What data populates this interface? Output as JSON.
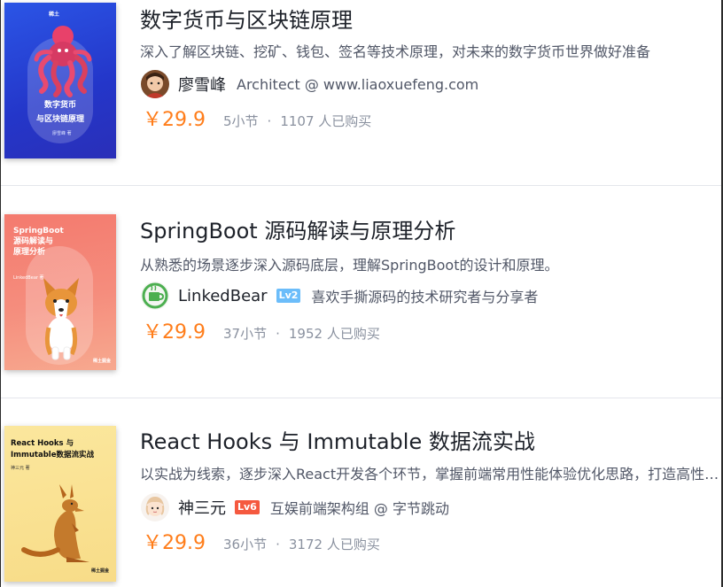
{
  "colors": {
    "price": "#ff7d1a",
    "title": "#1d2129",
    "secondary": "#515767",
    "muted": "#8a919f",
    "level_lv2": "#6cbdfa",
    "level_lv6": "#f5593f"
  },
  "books": [
    {
      "title": "数字货币与区块链原理",
      "description": "深入了解区块链、挖矿、钱包、签名等技术原理，对未来的数字货币世界做好准备",
      "cover": {
        "line1": "数字货币",
        "line2": "与区块链原理",
        "author": "廖雪峰 著",
        "brand": "稀土",
        "image": "octopus-illustration"
      },
      "author": {
        "name": "廖雪峰",
        "level": "",
        "title": "Architect @ www.liaoxuefeng.com",
        "avatar": "avatar-icon"
      },
      "price": "￥29.9",
      "sections": "5小节",
      "separator": "·",
      "buyers": "1107 人已购买"
    },
    {
      "title": "SpringBoot 源码解读与原理分析",
      "description": "从熟悉的场景逐步深入源码底层，理解SpringBoot的设计和原理。",
      "cover": {
        "line1": "SpringBoot",
        "line2": "源码解读与",
        "line3": "原理分析",
        "author": "LinkedBear 著",
        "brand": "稀土掘金",
        "image": "corgi-illustration"
      },
      "author": {
        "name": "LinkedBear",
        "level": "Lv2",
        "title": "喜欢手撕源码的技术研究者与分享者",
        "avatar": "avatar-icon"
      },
      "price": "￥29.9",
      "sections": "37小节",
      "separator": "·",
      "buyers": "1952 人已购买"
    },
    {
      "title": "React Hooks 与 Immutable 数据流实战",
      "description": "以实战为线索，逐步深入React开发各个环节，掌握前端常用性能体验优化思路，打造高性能Web应用",
      "cover": {
        "line1": "React Hooks 与",
        "line2": "Immutable数据流实战",
        "author": "神三元 著",
        "brand": "稀土掘金",
        "image": "kangaroo-illustration"
      },
      "author": {
        "name": "神三元",
        "level": "Lv6",
        "title": "互娱前端架构组 @ 字节跳动",
        "avatar": "avatar-icon"
      },
      "price": "￥29.9",
      "sections": "36小节",
      "separator": "·",
      "buyers": "3172 人已购买"
    }
  ]
}
